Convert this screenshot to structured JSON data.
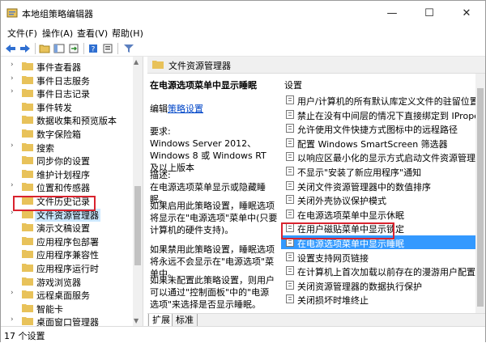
{
  "window": {
    "title": "本地组策略编辑器",
    "minimize": "—",
    "maximize": "☐",
    "close": "✕"
  },
  "menu": [
    "文件(F)",
    "操作(A)",
    "查看(V)",
    "帮助(H)"
  ],
  "toolbar_icons": [
    "back-icon",
    "forward-icon",
    "folder-up-icon",
    "show-hide-tree-icon",
    "export-icon",
    "help-icon",
    "properties-icon",
    "filter-icon"
  ],
  "tree": {
    "items": [
      {
        "label": "事件查看器",
        "arrow": "›"
      },
      {
        "label": "事件日志服务",
        "arrow": "›"
      },
      {
        "label": "事件日志记录",
        "arrow": "›"
      },
      {
        "label": "事件转发",
        "arrow": ""
      },
      {
        "label": "数据收集和预览版本",
        "arrow": ""
      },
      {
        "label": "数字保险箱",
        "arrow": ""
      },
      {
        "label": "搜索",
        "arrow": "›"
      },
      {
        "label": "同步你的设置",
        "arrow": ""
      },
      {
        "label": "维护计划程序",
        "arrow": ""
      },
      {
        "label": "位置和传感器",
        "arrow": "›"
      },
      {
        "label": "文件历史记录",
        "arrow": ""
      },
      {
        "label": "文件资源管理器",
        "arrow": "›",
        "selected": true
      },
      {
        "label": "演示文稿设置",
        "arrow": ""
      },
      {
        "label": "应用程序包部署",
        "arrow": ""
      },
      {
        "label": "应用程序兼容性",
        "arrow": ""
      },
      {
        "label": "应用程序运行时",
        "arrow": ""
      },
      {
        "label": "游戏浏览器",
        "arrow": ""
      },
      {
        "label": "远程桌面服务",
        "arrow": "›"
      },
      {
        "label": "智能卡",
        "arrow": ""
      },
      {
        "label": "桌面窗口管理器",
        "arrow": "›"
      }
    ]
  },
  "right_header": "文件资源管理器",
  "description": {
    "title": "在电源选项菜单中显示睡眠",
    "edit_prefix": "编辑",
    "edit_link": "策略设置",
    "requirements_label": "要求:",
    "requirements": "Windows Server 2012、Windows 8 或 Windows RT 及以上版本",
    "desc_label": "描述:",
    "desc": "在电源选项菜单显示或隐藏睡眠。",
    "p1": "如果启用此策略设置，睡眠选项将显示在\"电源选项\"菜单中(只要计算机的硬件支持)。",
    "p2": "如果禁用此策略设置，睡眠选项将永远不会显示在\"电源选项\"菜单中。",
    "p3": "如果未配置此策略设置，则用户可以通过\"控制面板\"中的\"电源选项\"来选择是否显示睡眠。"
  },
  "settings": {
    "header": "设置",
    "items": [
      "用户/计算机的所有默认库定义文件的驻留位置",
      "禁止在没有中间层的情况下直接绑定到 IPropertySet",
      "允许使用文件快捷方式图标中的远程路径",
      "配置 Windows SmartScreen 筛选器",
      "以响应区最小化的显示方式启动文件资源管理器",
      "不显示\"安装了新应用程序\"通知",
      "关闭文件资源管理器中的数值排序",
      "关闭外壳协议保护模式",
      "在电源选项菜单中显示休眠",
      "在用户磁贴菜单中显示锁定",
      "在电源选项菜单中显示睡眠",
      "设置支持网页链接",
      "在计算机上首次加载以前存在的漫游用户配置文件时",
      "关闭资源管理器的数据执行保护",
      "关闭损坏时堆终止"
    ],
    "selected_index": 10
  },
  "tabs": [
    "扩展",
    "标准"
  ],
  "status": "17 个设置"
}
